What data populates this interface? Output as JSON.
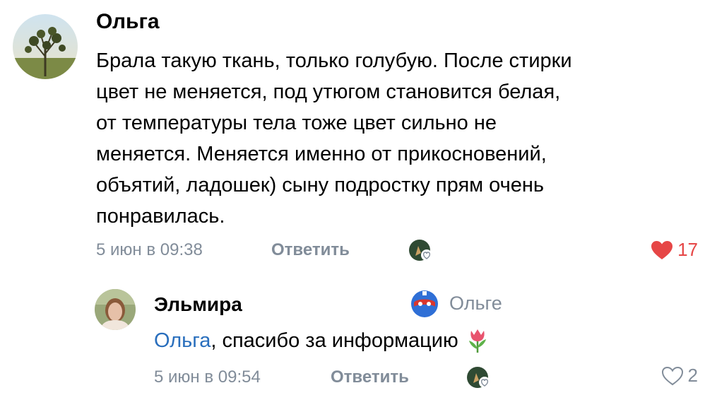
{
  "comment": {
    "author": "Ольга",
    "avatar_icon": "plant-avatar",
    "text_lines": [
      "Брала такую ткань, только голубую. После стирки",
      "цвет не меняется, под утюгом становится белая,",
      "от температуры тела тоже цвет сильно не",
      "меняется. Меняется именно от прикосновений,",
      "объятий, ладошек) сыну подростку прям очень",
      "понравилась."
    ],
    "time": "5 июн в 09:38",
    "reply_label": "Ответить",
    "likes": "17",
    "liked": true,
    "like_color": "#e64646"
  },
  "reply": {
    "author": "Эльмира",
    "avatar_icon": "woman-avatar",
    "to_icon": "masked-hero-icon",
    "to_name": "Ольге",
    "mention": "Ольга",
    "text": ", спасибо за информацию",
    "emoji": "tulip",
    "time": "5 июн в 09:54",
    "reply_label": "Ответить",
    "likes": "2",
    "liked": false
  }
}
